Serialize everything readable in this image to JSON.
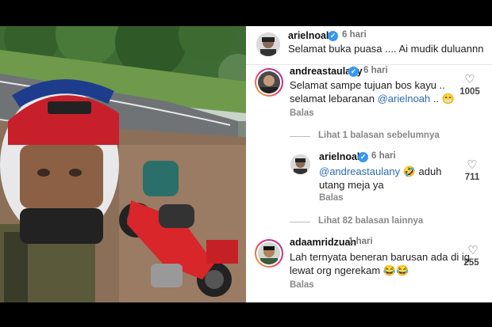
{
  "post": {
    "author": "arielnoah",
    "time": "6 hari",
    "caption": "Selamat buka puasa .... Ai mudik duluannn"
  },
  "comments": [
    {
      "username": "andreastaulany",
      "time": "6 hari",
      "text_line1": "Selamat sampe tujuan bos kayu ..",
      "text_line2_prefix": "selamat lebaranan ",
      "mention": "@arielnoah",
      "text_line2_suffix": " .. 😁",
      "likes": "1005",
      "reply_label": "Balas"
    },
    {
      "view_replies": "Lihat 1 balasan sebelumnya"
    },
    {
      "username": "arielnoah",
      "time": "6 hari",
      "mention": "@andreastaulany",
      "text_line1_suffix": " 🤣 aduh",
      "text_line2": "utang meja ya",
      "likes": "711",
      "reply_label": "Balas"
    },
    {
      "view_replies": "Lihat 82 balasan lainnya"
    },
    {
      "username": "adaamridzuan",
      "time": "1 hari",
      "text_line1": "Lah ternyata beneran barusan ada di ig",
      "text_line2": "lewat org ngerekam 😂😂",
      "likes": "255",
      "reply_label": "Balas"
    }
  ],
  "icons": {
    "verified": "✓",
    "heart": "♡"
  },
  "colors": {
    "verified_blue": "#3897f0",
    "mention_blue": "#2b6cb0"
  }
}
